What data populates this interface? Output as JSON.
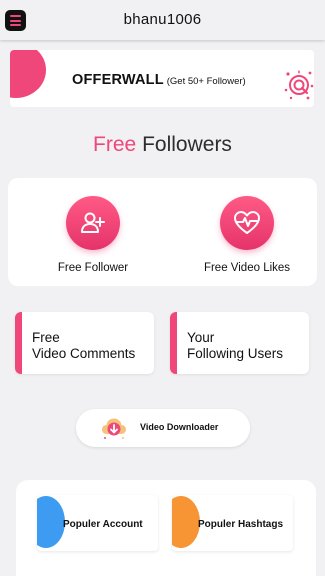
{
  "header": {
    "username": "bhanu1006",
    "menu_icon": "hamburger-menu-icon"
  },
  "offerwall": {
    "title": "OFFERWALL",
    "subtitle": "(Get 50+ Follower)",
    "icon": "search-badge-icon"
  },
  "section": {
    "title_accent": "Free",
    "title_rest": "Followers"
  },
  "features": [
    {
      "label": "Free Follower",
      "icon": "add-user-icon"
    },
    {
      "label": "Free Video Likes",
      "icon": "heart-pulse-icon"
    }
  ],
  "pills": [
    {
      "line1": "Free",
      "line2": "Video Comments"
    },
    {
      "line1": "Your",
      "line2": "Following Users"
    }
  ],
  "downloader": {
    "label": "Video Downloader",
    "icon": "cloud-download-icon"
  },
  "bottom": {
    "items": [
      {
        "label": "Populer Account"
      },
      {
        "label": "Populer Hashtags"
      }
    ]
  },
  "colors": {
    "accent": "#f0477a",
    "background": "#f1f1f3",
    "blue": "#3d9cf2",
    "orange": "#f79535"
  }
}
